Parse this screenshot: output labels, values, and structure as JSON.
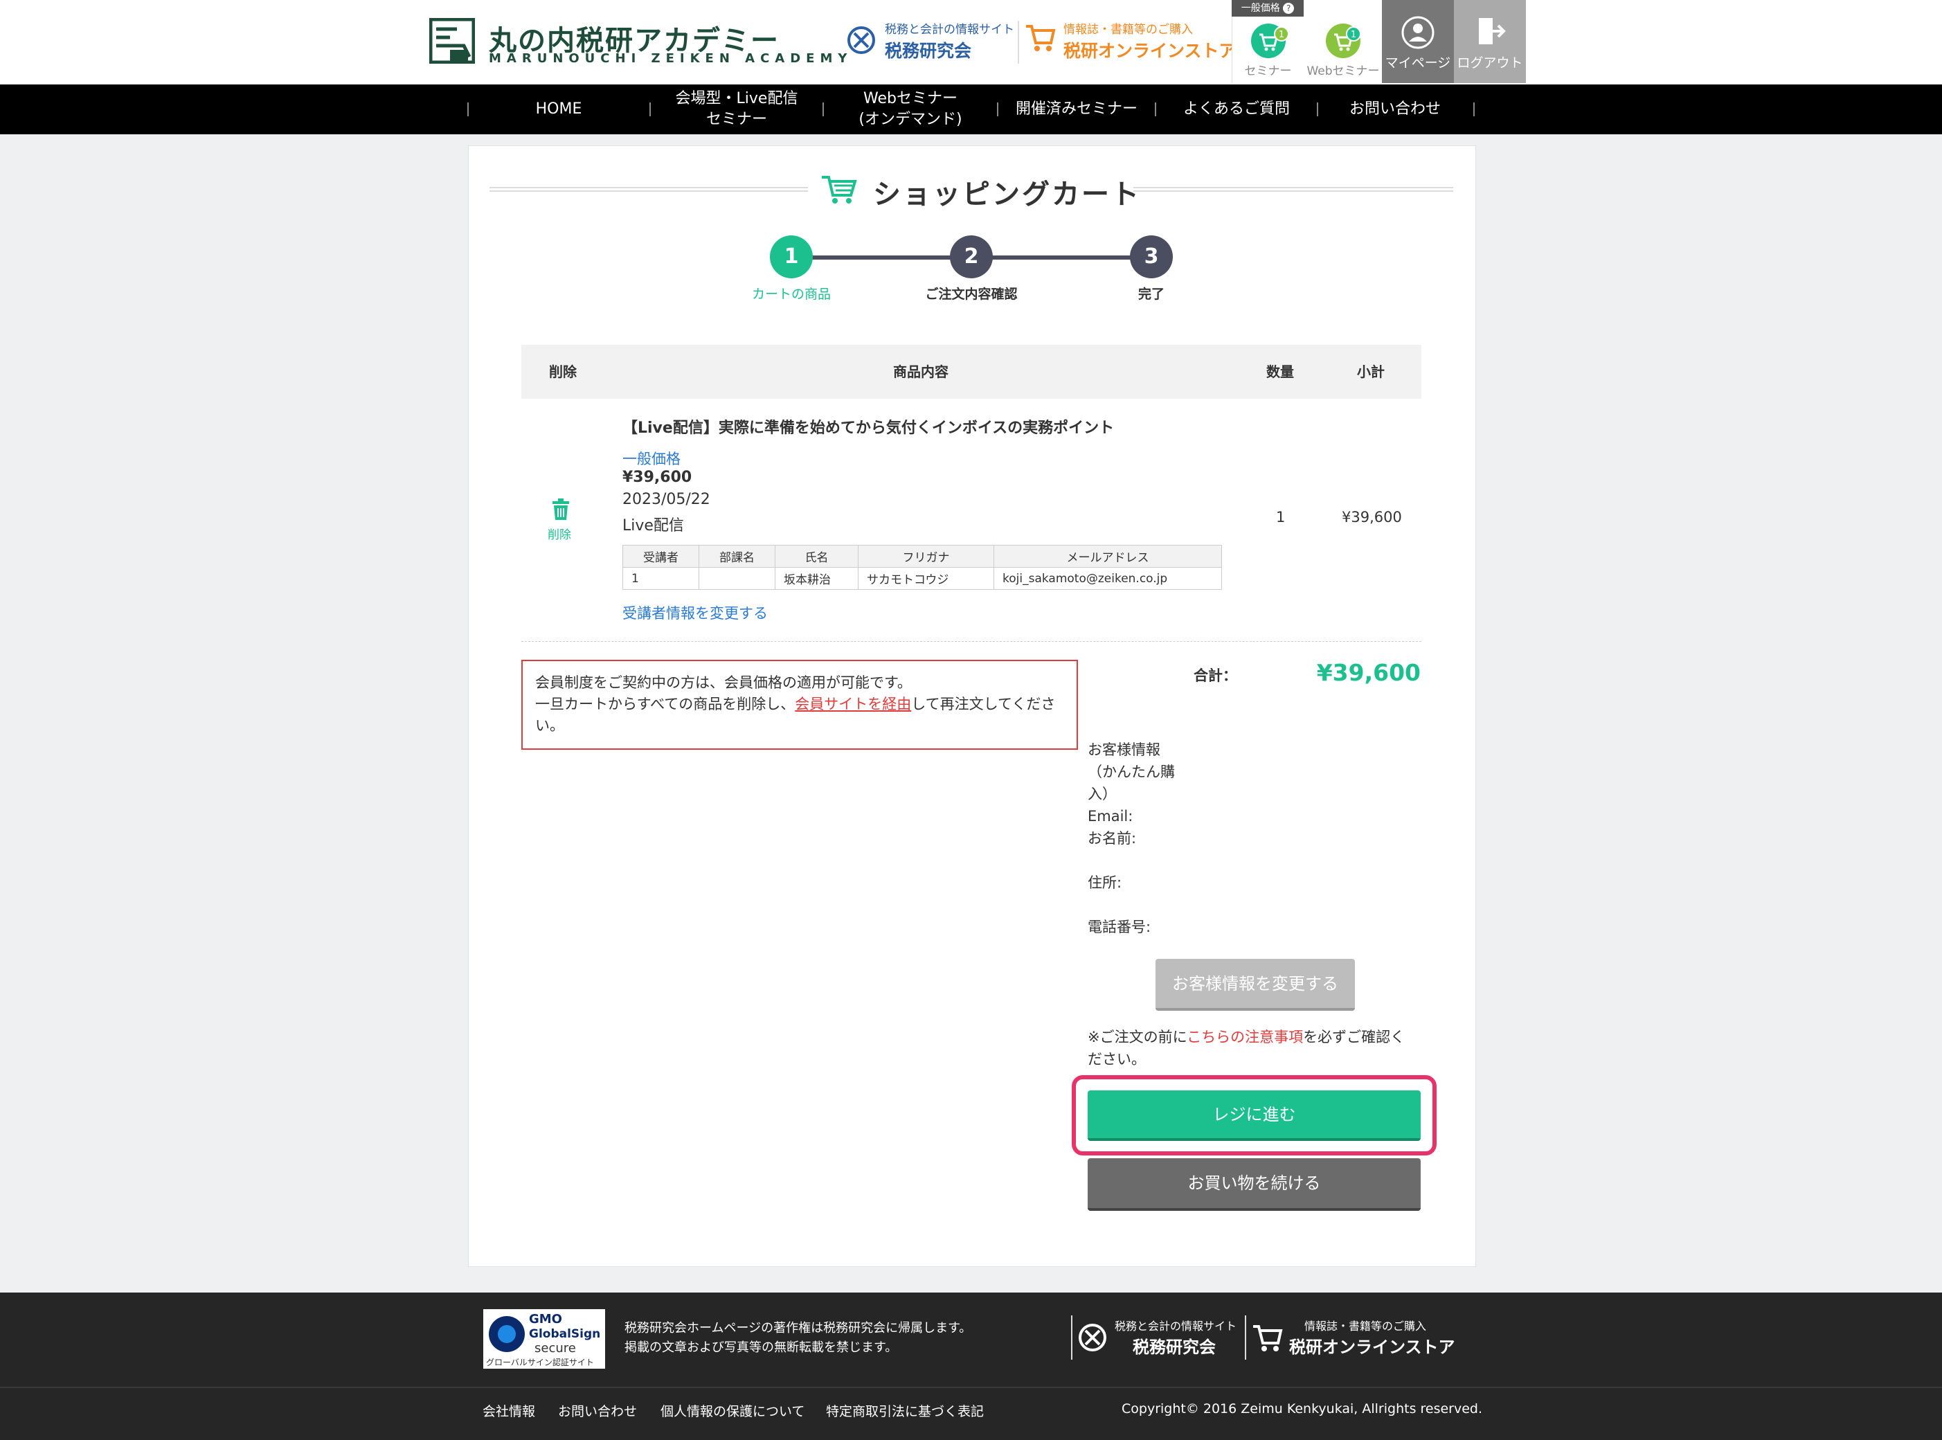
{
  "header": {
    "logo_title": "丸の内税研アカデミー",
    "logo_sub": "MARUNOUCHI ZEIKEN ACADEMY",
    "link1_small": "税務と会計の情報サイト",
    "link1_big": "税務研究会",
    "link2_small": "情報誌・書籍等のご購入",
    "link2_big": "税研オンラインストア",
    "price_tag": "一般価格",
    "tile_seminar": "セミナー",
    "tile_seminar_count": "1",
    "tile_web": "Webセミナー",
    "tile_web_count": "1",
    "tile_mypage": "マイページ",
    "tile_logout": "ログアウト"
  },
  "nav": {
    "home": "HOME",
    "venue_l1": "会場型・Live配信",
    "venue_l2": "セミナー",
    "web_l1": "Webセミナー",
    "web_l2": "(オンデマンド)",
    "past": "開催済みセミナー",
    "faq": "よくあるご質問",
    "contact": "お問い合わせ"
  },
  "cart": {
    "title": "ショッピングカート",
    "steps": [
      {
        "num": "1",
        "label": "カートの商品"
      },
      {
        "num": "2",
        "label": "ご注文内容確認"
      },
      {
        "num": "3",
        "label": "完了"
      }
    ],
    "table_headers": {
      "delete": "削除",
      "content": "商品内容",
      "qty": "数量",
      "subtotal": "小計"
    },
    "item": {
      "delete_label": "削除",
      "title": "【Live配信】実際に準備を始めてから気付くインボイスの実務ポイント",
      "price_type": "一般価格",
      "price": "¥39,600",
      "date": "2023/05/22",
      "type": "Live配信",
      "qty": "1",
      "subtotal": "¥39,600",
      "attendee_headers": [
        "受講者",
        "部課名",
        "氏名",
        "フリガナ",
        "メールアドレス"
      ],
      "attendee_row": [
        "1",
        "",
        "坂本耕治",
        "サカモトコウジ",
        "koji_sakamoto@zeiken.co.jp"
      ],
      "change_attendee": "受講者情報を変更する"
    },
    "notice_l1": "会員制度をご契約中の方は、会員価格の適用が可能です。",
    "notice_l2a": "一旦カートからすべての商品を削除し、",
    "notice_link": "会員サイトを経由",
    "notice_l2b": "して再注文してくださ",
    "notice_l3": "い。",
    "total_label": "合計：",
    "total_value": "¥39,600",
    "customer": {
      "info_l1": "お客様情報",
      "info_l2": "（かんたん購",
      "info_l3": "入）",
      "email": "Email:",
      "name": "お名前:",
      "address": "住所:",
      "phone": "電話番号:"
    },
    "edit_customer_button": "お客様情報を変更する",
    "caution_a": "※ご注文の前に",
    "caution_link": "こちらの注意事項",
    "caution_b": "を必ずご確認く",
    "caution_c": "ださい。",
    "register_button": "レジに進む",
    "continue_button": "お買い物を続ける"
  },
  "footer": {
    "gmo_1": "GMO",
    "gmo_2": "GlobalSign",
    "gmo_3": "secure",
    "gmo_4": "グローバルサイン認証サイト",
    "copy_l1": "税務研究会ホームページの著作権は税務研究会に帰属します。",
    "copy_l2": "掲載の文章および写真等の無断転載を禁じます。",
    "link1_small": "税務と会計の情報サイト",
    "link1_big": "税務研究会",
    "link2_small": "情報誌・書籍等のご購入",
    "link2_big": "税研オンラインストア",
    "nav": [
      "会社情報",
      "お問い合わせ",
      "個人情報の保護について",
      "特定商取引法に基づく表記"
    ],
    "copyright": "Copyright© 2016 Zeimu Kenkyukai, Allrights reserved."
  },
  "colors": {
    "accent": "#1cbf8e",
    "alert": "#e13b3b",
    "highlight": "#e8336a",
    "link": "#2b7bd6"
  }
}
